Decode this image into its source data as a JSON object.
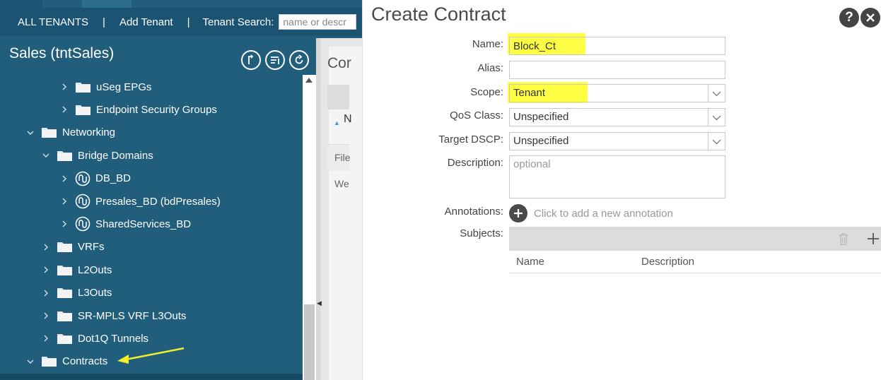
{
  "topnav": {
    "all_tenants": "ALL TENANTS",
    "sep1": "|",
    "add_tenant": "Add Tenant",
    "sep2": "|",
    "search_label": "Tenant Search:",
    "search_placeholder": "name or descr"
  },
  "tenant": {
    "title": "Sales (tntSales)"
  },
  "tree": [
    {
      "label": "uSeg EPGs",
      "icon": "folder-icon",
      "expanded": false
    },
    {
      "label": "Endpoint Security Groups",
      "icon": "folder-icon",
      "expanded": false
    },
    {
      "label": "Networking",
      "icon": "folder-icon",
      "expanded": true
    },
    {
      "label": "Bridge Domains",
      "icon": "folder-icon",
      "expanded": true
    },
    {
      "label": "DB_BD",
      "icon": "bridge-domain-icon",
      "expanded": false
    },
    {
      "label": "Presales_BD (bdPresales)",
      "icon": "bridge-domain-icon",
      "expanded": false
    },
    {
      "label": "SharedServices_BD",
      "icon": "bridge-domain-icon",
      "expanded": false
    },
    {
      "label": "VRFs",
      "icon": "folder-icon",
      "expanded": false
    },
    {
      "label": "L2Outs",
      "icon": "folder-icon",
      "expanded": false
    },
    {
      "label": "L3Outs",
      "icon": "folder-icon",
      "expanded": false
    },
    {
      "label": "SR-MPLS VRF L3Outs",
      "icon": "folder-icon",
      "expanded": false
    },
    {
      "label": "Dot1Q Tunnels",
      "icon": "folder-icon",
      "expanded": false
    },
    {
      "label": "Contracts",
      "icon": "folder-icon",
      "expanded": true
    }
  ],
  "middle": {
    "heading": "Cor",
    "row_label": "N",
    "file_label": "File",
    "we_label": "We"
  },
  "dialog": {
    "title": "Create Contract",
    "help": "?",
    "labels": {
      "name": "Name:",
      "alias": "Alias:",
      "scope": "Scope:",
      "qos": "QoS Class:",
      "dscp": "Target DSCP:",
      "description": "Description:",
      "annotations": "Annotations:",
      "subjects": "Subjects:"
    },
    "values": {
      "name": "Block_Ct",
      "alias": "",
      "scope": "Tenant",
      "qos": "Unspecified",
      "dscp": "Unspecified"
    },
    "description_placeholder": "optional",
    "annotation_prompt": "Click to add a new annotation",
    "subjects_columns": [
      "Name",
      "Description"
    ]
  },
  "colors": {
    "panel_bg": "#215e7c",
    "nav_bg": "#1b5472",
    "highlight": "#ffff44",
    "arrow": "#f7ee2a"
  }
}
